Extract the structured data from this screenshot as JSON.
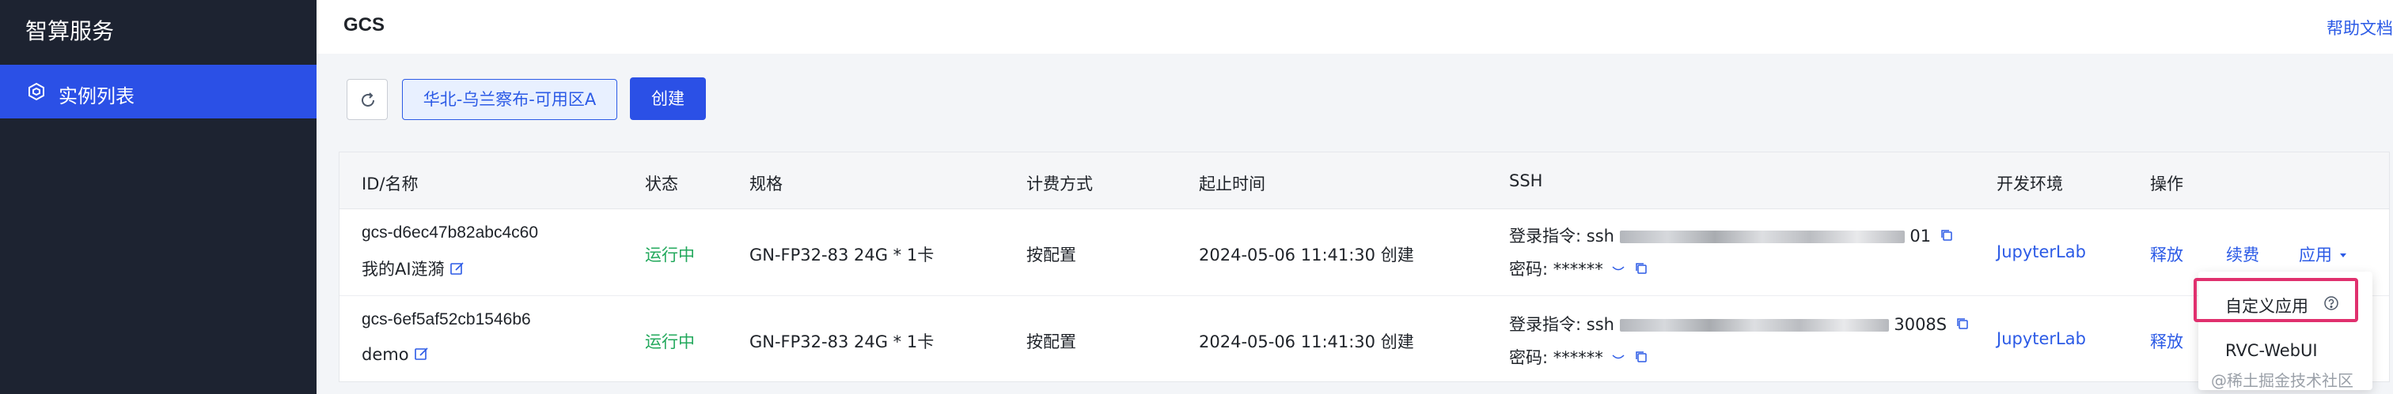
{
  "sidebar": {
    "brand": "智算服务",
    "items": [
      {
        "label": "实例列表",
        "icon": "box-icon",
        "active": true
      }
    ]
  },
  "header": {
    "title": "GCS",
    "help": "帮助文档"
  },
  "toolbar": {
    "refresh_icon": "refresh-icon",
    "region": "华北-乌兰察布-可用区A",
    "create": "创建"
  },
  "table": {
    "columns": [
      "ID/名称",
      "状态",
      "规格",
      "计费方式",
      "起止时间",
      "SSH",
      "开发环境",
      "操作"
    ],
    "rows": [
      {
        "id": "gcs-d6ec47b82abc4c60",
        "name": "我的AI涟漪",
        "status": "运行中",
        "spec": "GN-FP32-83 24G * 1卡",
        "billing": "按配置",
        "time": "2024-05-06 11:41:30 创建",
        "ssh_cmd_label": "登录指令:",
        "ssh_cmd_prefix": "ssh",
        "ssh_cmd_suffix": "01",
        "pwd_label": "密码:",
        "pwd": "******",
        "dev_env": "JupyterLab",
        "actions": [
          "释放",
          "续费",
          "应用"
        ]
      },
      {
        "id": "gcs-6ef5af52cb1546b6",
        "name": "demo",
        "status": "运行中",
        "spec": "GN-FP32-83 24G * 1卡",
        "billing": "按配置",
        "time": "2024-05-06 11:41:30 创建",
        "ssh_cmd_label": "登录指令:",
        "ssh_cmd_prefix": "ssh",
        "ssh_cmd_suffix": "3008S",
        "pwd_label": "密码:",
        "pwd": "******",
        "dev_env": "JupyterLab",
        "actions": [
          "释放"
        ]
      }
    ]
  },
  "dropdown": {
    "items": [
      "自定义应用",
      "RVC-WebUI"
    ]
  },
  "watermark": "@稀土掘金技术社区",
  "colors": {
    "sidebar_bg": "#1d2331",
    "accent": "#2b50e6",
    "status_running": "#21a85b",
    "highlight": "#e0306e"
  }
}
